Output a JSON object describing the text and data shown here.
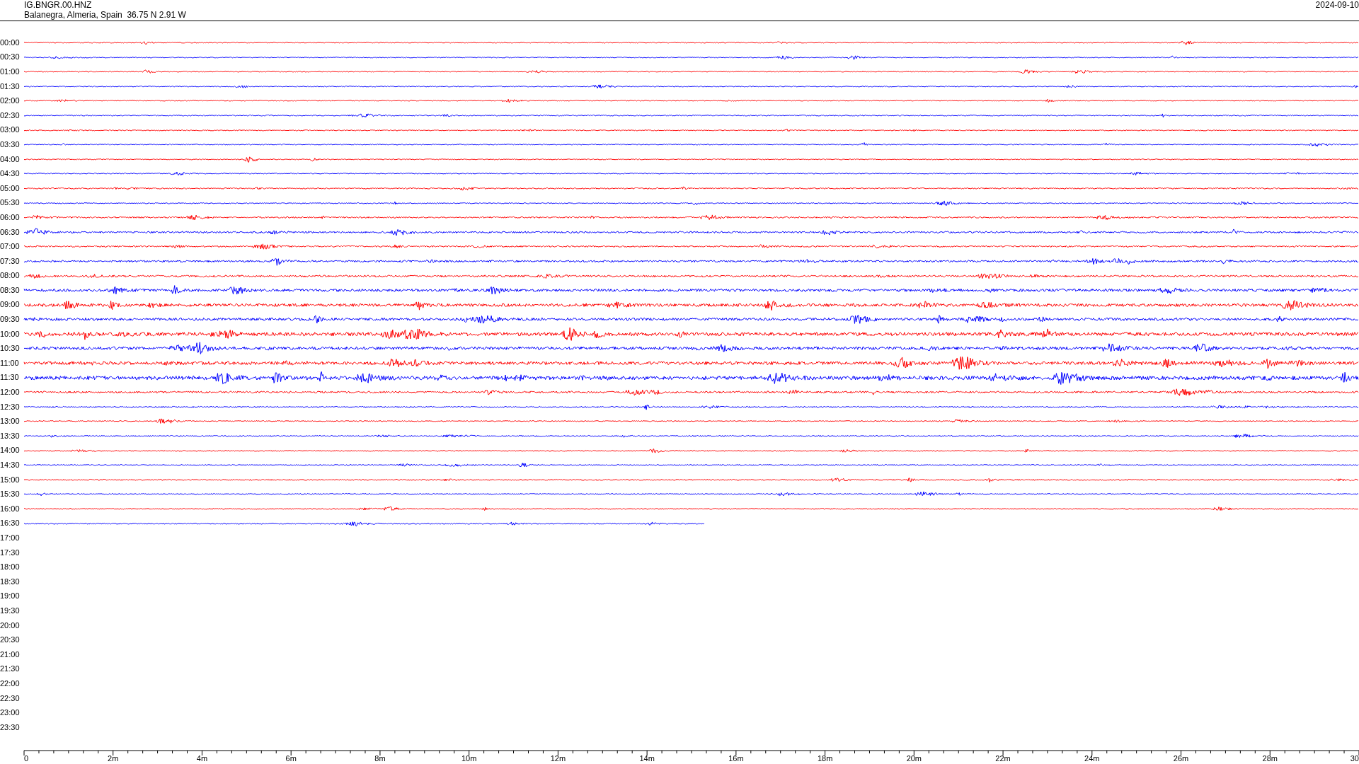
{
  "header": {
    "station": "IG.BNGR.00.HNZ",
    "location": "Balanegra, Almeria, Spain  36.75 N 2.91 W",
    "date": "2024-09-10"
  },
  "rows": [
    {
      "time": "00:00",
      "color": "#ff0000",
      "kind": "full"
    },
    {
      "time": "00:30",
      "color": "#0000ff",
      "kind": "full"
    },
    {
      "time": "01:00",
      "color": "#ff0000",
      "kind": "full"
    },
    {
      "time": "01:30",
      "color": "#0000ff",
      "kind": "full"
    },
    {
      "time": "02:00",
      "color": "#ff0000",
      "kind": "full"
    },
    {
      "time": "02:30",
      "color": "#0000ff",
      "kind": "full"
    },
    {
      "time": "03:00",
      "color": "#ff0000",
      "kind": "full"
    },
    {
      "time": "03:30",
      "color": "#0000ff",
      "kind": "full"
    },
    {
      "time": "04:00",
      "color": "#ff0000",
      "kind": "full"
    },
    {
      "time": "04:30",
      "color": "#0000ff",
      "kind": "full"
    },
    {
      "time": "05:00",
      "color": "#ff0000",
      "kind": "full"
    },
    {
      "time": "05:30",
      "color": "#0000ff",
      "kind": "full"
    },
    {
      "time": "06:00",
      "color": "#ff0000",
      "kind": "full"
    },
    {
      "time": "06:30",
      "color": "#0000ff",
      "kind": "full"
    },
    {
      "time": "07:00",
      "color": "#ff0000",
      "kind": "full"
    },
    {
      "time": "07:30",
      "color": "#0000ff",
      "kind": "full"
    },
    {
      "time": "08:00",
      "color": "#ff0000",
      "kind": "full"
    },
    {
      "time": "08:30",
      "color": "#0000ff",
      "kind": "full"
    },
    {
      "time": "09:00",
      "color": "#ff0000",
      "kind": "full"
    },
    {
      "time": "09:30",
      "color": "#0000ff",
      "kind": "full"
    },
    {
      "time": "10:00",
      "color": "#ff0000",
      "kind": "full"
    },
    {
      "time": "10:30",
      "color": "#0000ff",
      "kind": "full"
    },
    {
      "time": "11:00",
      "color": "#ff0000",
      "kind": "full"
    },
    {
      "time": "11:30",
      "color": "#0000ff",
      "kind": "full"
    },
    {
      "time": "12:00",
      "color": "#ff0000",
      "kind": "full"
    },
    {
      "time": "12:30",
      "color": "#0000ff",
      "kind": "full"
    },
    {
      "time": "13:00",
      "color": "#ff0000",
      "kind": "full"
    },
    {
      "time": "13:30",
      "color": "#0000ff",
      "kind": "full"
    },
    {
      "time": "14:00",
      "color": "#ff0000",
      "kind": "full"
    },
    {
      "time": "14:30",
      "color": "#0000ff",
      "kind": "full"
    },
    {
      "time": "15:00",
      "color": "#ff0000",
      "kind": "full"
    },
    {
      "time": "15:30",
      "color": "#0000ff",
      "kind": "full"
    },
    {
      "time": "16:00",
      "color": "#ff0000",
      "kind": "full"
    },
    {
      "time": "16:30",
      "color": "#0000ff",
      "kind": "partial"
    },
    {
      "time": "17:00",
      "kind": "empty"
    },
    {
      "time": "17:30",
      "kind": "empty"
    },
    {
      "time": "18:00",
      "kind": "empty"
    },
    {
      "time": "18:30",
      "kind": "empty"
    },
    {
      "time": "19:00",
      "kind": "empty"
    },
    {
      "time": "19:30",
      "kind": "empty"
    },
    {
      "time": "20:00",
      "kind": "empty"
    },
    {
      "time": "20:30",
      "kind": "empty"
    },
    {
      "time": "21:00",
      "kind": "empty"
    },
    {
      "time": "21:30",
      "kind": "empty"
    },
    {
      "time": "22:00",
      "kind": "empty"
    },
    {
      "time": "22:30",
      "kind": "empty"
    },
    {
      "time": "23:00",
      "kind": "empty"
    },
    {
      "time": "23:30",
      "kind": "empty"
    }
  ],
  "x_axis": {
    "labels": [
      "0",
      "2m",
      "4m",
      "6m",
      "8m",
      "10m",
      "12m",
      "14m",
      "16m",
      "18m",
      "20m",
      "22m",
      "24m",
      "26m",
      "28m",
      "30"
    ]
  }
}
